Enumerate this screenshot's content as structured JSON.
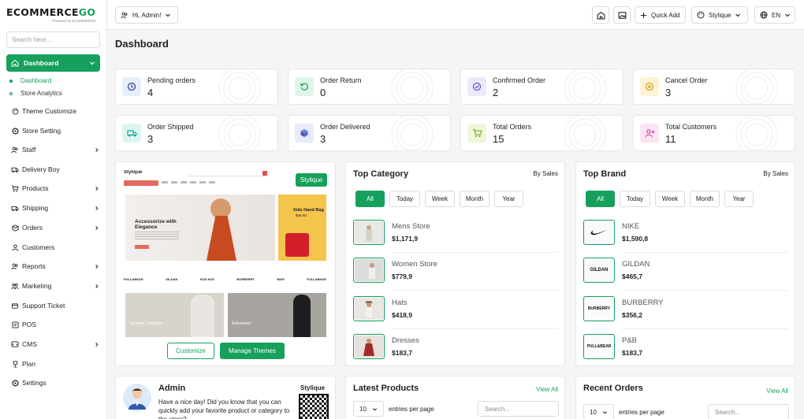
{
  "brand": {
    "logo_main": "ECOMMERCE",
    "logo_accent": "GO",
    "logo_sub": "Powered by ECOMMERCE"
  },
  "colors": {
    "accent": "#16a05c"
  },
  "sidebar": {
    "search_placeholder": "Search here...",
    "dashboard_label": "Dashboard",
    "sub_items": [
      {
        "label": "Dashboard"
      },
      {
        "label": "Store Analytics"
      }
    ],
    "items": [
      {
        "label": "Theme Customize",
        "icon": "brush-icon"
      },
      {
        "label": "Store Setting",
        "icon": "gear-icon"
      },
      {
        "label": "Staff",
        "icon": "users-icon"
      },
      {
        "label": "Delivery Boy",
        "icon": "truck-icon"
      },
      {
        "label": "Products",
        "icon": "cart-icon"
      },
      {
        "label": "Shipping",
        "icon": "shipping-icon"
      },
      {
        "label": "Orders",
        "icon": "orders-icon"
      },
      {
        "label": "Customers",
        "icon": "customers-icon"
      },
      {
        "label": "Reports",
        "icon": "reports-icon"
      },
      {
        "label": "Marketing",
        "icon": "marketing-icon"
      },
      {
        "label": "Support Ticket",
        "icon": "ticket-icon"
      },
      {
        "label": "POS",
        "icon": "pos-icon"
      },
      {
        "label": "CMS",
        "icon": "cms-icon"
      },
      {
        "label": "Plan",
        "icon": "trophy-icon"
      },
      {
        "label": "Settings",
        "icon": "settings-icon"
      }
    ]
  },
  "topbar": {
    "greeting": "Hi, Admin!",
    "quick_add": "Quick Add",
    "store": "Stylique",
    "lang": "EN"
  },
  "page_title": "Dashboard",
  "stats": [
    {
      "label": "Pending orders",
      "value": "4",
      "icon": "clock-icon"
    },
    {
      "label": "Order Return",
      "value": "0",
      "icon": "return-icon"
    },
    {
      "label": "Confirmed Order",
      "value": "2",
      "icon": "check-icon"
    },
    {
      "label": "Cancel Order",
      "value": "3",
      "icon": "cancel-icon"
    },
    {
      "label": "Order Shipped",
      "value": "3",
      "icon": "truck-icon"
    },
    {
      "label": "Order Delivered",
      "value": "3",
      "icon": "box-icon"
    },
    {
      "label": "Total Orders",
      "value": "15",
      "icon": "cart-icon"
    },
    {
      "label": "Total Customers",
      "value": "11",
      "icon": "user-plus-icon"
    }
  ],
  "theme": {
    "badge": "Stylique",
    "preview_logo": "Stylique",
    "hero_title": "Accessorize with Elegance",
    "side_title": "Side Hand Bag",
    "side_price": "$46.00",
    "brands": [
      "PULL&BEAR",
      "GILDAN",
      "SOD NCE",
      "BURBERRY",
      "NIKE",
      "PULL&BEAR"
    ],
    "tile1": "Summer Collection",
    "tile2": "Activewear",
    "customize": "Customize",
    "manage": "Manage Themes"
  },
  "top_category": {
    "title": "Top Category",
    "by": "By Sales",
    "filters": [
      "All",
      "Today",
      "Week",
      "Month",
      "Year"
    ],
    "items": [
      {
        "name": "Mens Store",
        "amount": "$1,171,9"
      },
      {
        "name": "Women Store",
        "amount": "$779,9"
      },
      {
        "name": "Hats",
        "amount": "$418,9"
      },
      {
        "name": "Dresses",
        "amount": "$183,7"
      }
    ]
  },
  "top_brand": {
    "title": "Top Brand",
    "by": "By Sales",
    "filters": [
      "All",
      "Today",
      "Week",
      "Month",
      "Year"
    ],
    "items": [
      {
        "name": "NIKE",
        "amount": "$1,590,8",
        "logo": "nike-swoosh"
      },
      {
        "name": "GILDAN",
        "amount": "$465,7",
        "logo": "GILDAN"
      },
      {
        "name": "BURBERRY",
        "amount": "$356,2",
        "logo": "BURBERRY"
      },
      {
        "name": "P&B",
        "amount": "$183,7",
        "logo": "PULL&BEAR"
      }
    ]
  },
  "admin": {
    "title": "Admin",
    "store": "Stylique",
    "message": "Have a nice day! Did you know that you can quickly add your favorite product or category to the store?"
  },
  "latest_products": {
    "title": "Latest Products",
    "view_all": "View All",
    "per_page": "10",
    "per_page_label": "entries per page",
    "search_placeholder": "Search..."
  },
  "recent_orders": {
    "title": "Recent Orders",
    "view_all": "View All",
    "per_page": "10",
    "per_page_label": "entries per page",
    "search_placeholder": "Search..."
  }
}
